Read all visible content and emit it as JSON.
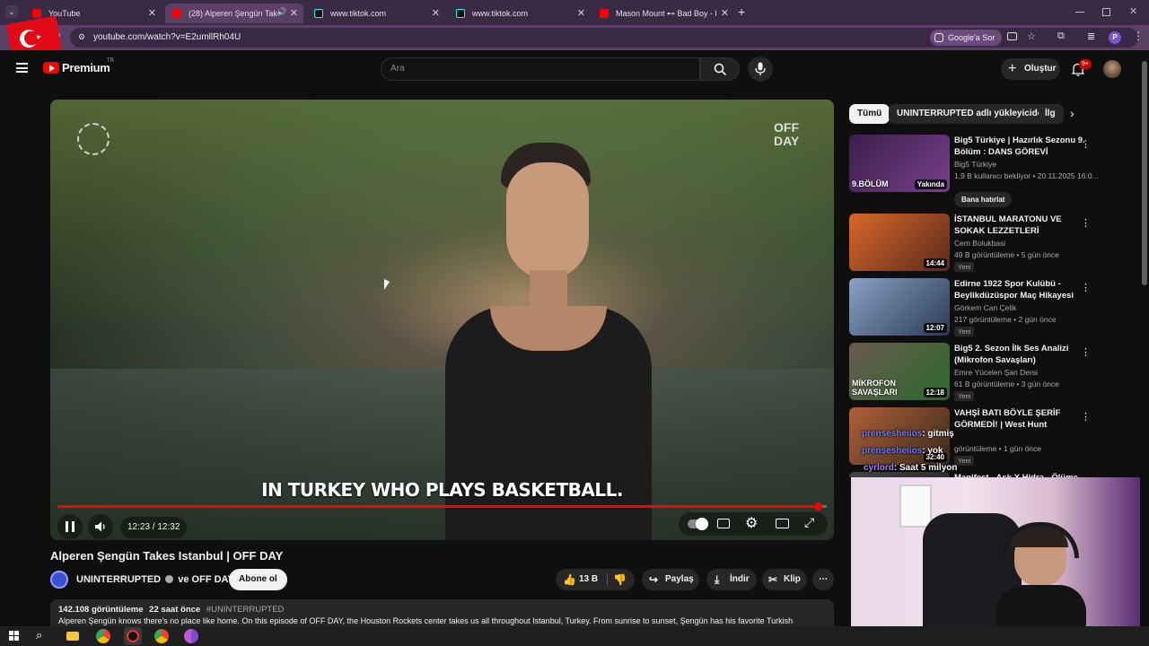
{
  "browser": {
    "tabs": [
      {
        "label": "YouTube",
        "icon": "youtube-icon"
      },
      {
        "label": "(28) Alperen Şengün Takes",
        "icon": "youtube-icon"
      },
      {
        "label": "www.tiktok.com",
        "icon": "tiktok-icon"
      },
      {
        "label": "www.tiktok.com",
        "icon": "tiktok-icon"
      },
      {
        "label": "Mason Mount ⊷ Bad Boy - Ma",
        "icon": "youtube-icon"
      }
    ],
    "new_tab": "+",
    "url": "youtube.com/watch?v=E2umllRh04U",
    "google_sor": "Google'a Sor",
    "profile_initial": "P"
  },
  "youtube": {
    "logo_text": "Premium",
    "region": "TR",
    "search_placeholder": "Ara",
    "create_label": "Oluştur",
    "notification_count": "9+"
  },
  "video": {
    "subtitle": "IN TURKEY WHO PLAYS BASKETBALL.",
    "watermark": "OFF DAY",
    "time_display": "12:23 / 12:32",
    "progress_fraction": 0.988,
    "title": "Alperen Şengün Takes Istanbul | OFF DAY",
    "channel": "UNINTERRUPTED",
    "channel_suffix": "ve OFF DAY",
    "subscribe_label": "Abone ol",
    "likes": "13 B",
    "share_label": "Paylaş",
    "download_label": "İndir",
    "clip_label": "Klip",
    "views": "142.108 görüntüleme",
    "posted": "22 saat önce",
    "hashtag": "#UNINTERRUPTED",
    "description": "Alperen Şengün knows there's no place like home. On this episode of OFF DAY, the Houston Rockets center takes us all throughout Istanbul, Turkey. From sunrise to sunset, Şengün has his favorite Turkish"
  },
  "sidebar": {
    "chips": [
      "Tümü",
      "UNINTERRUPTED adlı yükleyiciden",
      "İlg"
    ],
    "recommendations": [
      {
        "title": "Big5 Türkiye | Hazırlık Sezonu 9. Bölüm : DANS GÖREVİ",
        "channel": "Big5 Türkiye",
        "meta": "1,9 B kullanıcı bekliyor • 20.11.2025 16:0...",
        "duration": "Yakında",
        "badge": "Bana hatırlat",
        "overlay": "9.BÖLÜM",
        "thumb_colors": [
          "#3a1f4a",
          "#7a3f8c"
        ]
      },
      {
        "title": "İSTANBUL MARATONU VE SOKAK LEZZETLERİ",
        "channel": "Cem Bolukbasi",
        "meta": "49 B görüntüleme • 5 gün önce",
        "duration": "14:44",
        "badge": "Yeni",
        "thumb_colors": [
          "#d8672a",
          "#5b2a1c"
        ]
      },
      {
        "title": "Edirne 1922 Spor Kulübü - Beylikdüzüspor Maç Hikayesi",
        "channel": "Görkem Can Çelik",
        "meta": "217 görüntüleme • 2 gün önce",
        "duration": "12:07",
        "badge": "Yeni",
        "thumb_colors": [
          "#8aa2c4",
          "#2a3a56"
        ]
      },
      {
        "title": "Big5 2. Sezon İlk Ses Analizi (Mikrofon Savaşları)",
        "channel": "Emre Yücelen Şan Dersi",
        "meta": "61 B görüntüleme • 3 gün önce",
        "duration": "12:18",
        "badge": "Yeni",
        "overlay": "MİKROFON SAVAŞLARI",
        "thumb_colors": [
          "#6a5a50",
          "#2b6a2b"
        ]
      },
      {
        "title": "VAHŞİ BATI BÖYLE ŞERİF GÖRMEDİ! | West Hunt",
        "channel": "",
        "meta": "görüntüleme • 1 gün önce",
        "duration": "32:40",
        "badge": "Yeni",
        "thumb_colors": [
          "#b0603a",
          "#3a2a1a"
        ]
      },
      {
        "title": "Manifest - Aşk X Hidra - Ölüme",
        "channel": "",
        "meta": "",
        "duration": "",
        "badge": "",
        "thumb_colors": [
          "#444",
          "#222"
        ]
      }
    ]
  },
  "chat": [
    {
      "user": "prensesheiios",
      "message": ": gitmiş",
      "color": "#6f7cff"
    },
    {
      "user": "prensesheiios",
      "message": ": yok",
      "color": "#6f7cff"
    },
    {
      "user": "cyrlord",
      "message": ": Saat 5 milyon",
      "color": "#b07cff"
    }
  ],
  "colors": {
    "accent_red": "#ff0000",
    "bg": "#0f0f0f",
    "tab_strip": "#3b2a44",
    "address_row": "#5a3f66"
  }
}
